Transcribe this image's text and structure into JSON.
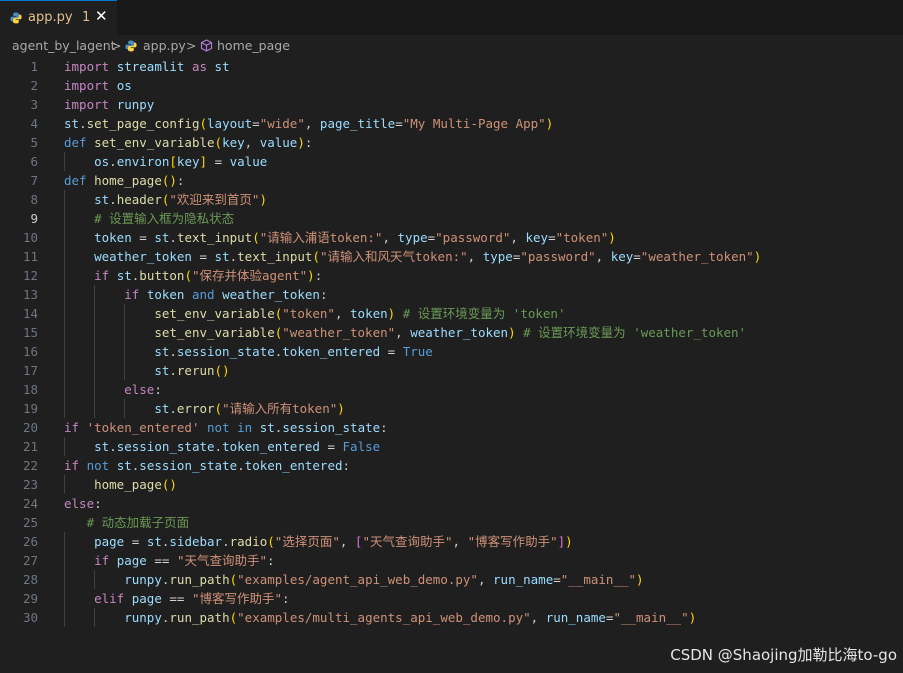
{
  "tab": {
    "filename": "app.py",
    "problem_count": "1",
    "close_symbol": "✕"
  },
  "breadcrumb": {
    "folder": "agent_by_lagent",
    "sep": ">",
    "file": "app.py",
    "symbol": "home_page"
  },
  "current_line": 9,
  "code_lines": [
    {
      "n": "1",
      "t": [
        [
          "import",
          "k"
        ],
        [
          " "
        ],
        [
          "streamlit",
          "v"
        ],
        [
          " "
        ],
        [
          "as",
          "k"
        ],
        [
          " "
        ],
        [
          "st",
          "v"
        ]
      ]
    },
    {
      "n": "2",
      "t": [
        [
          "import",
          "k"
        ],
        [
          " "
        ],
        [
          "os",
          "v"
        ]
      ]
    },
    {
      "n": "3",
      "t": [
        [
          "import",
          "k"
        ],
        [
          " "
        ],
        [
          "runpy",
          "v"
        ]
      ]
    },
    {
      "n": "4",
      "t": [
        [
          "st",
          "v"
        ],
        [
          "."
        ],
        [
          "set_page_config",
          "f"
        ],
        [
          "(",
          "p1"
        ],
        [
          "layout",
          "v"
        ],
        [
          "=",
          "op"
        ],
        [
          "\"wide\"",
          "s"
        ],
        [
          ", "
        ],
        [
          "page_title",
          "v"
        ],
        [
          "=",
          "op"
        ],
        [
          "\"My Multi-Page App\"",
          "s"
        ],
        [
          ")",
          "p1"
        ]
      ]
    },
    {
      "n": "5",
      "t": [
        [
          "def",
          "kb"
        ],
        [
          " "
        ],
        [
          "set_env_variable",
          "f"
        ],
        [
          "(",
          "p1"
        ],
        [
          "key",
          "v"
        ],
        [
          ", "
        ],
        [
          "value",
          "v"
        ],
        [
          ")",
          "p1"
        ],
        [
          ":"
        ]
      ]
    },
    {
      "n": "6",
      "t": [
        [
          "    "
        ],
        [
          "os",
          "v"
        ],
        [
          "."
        ],
        [
          "environ",
          "v"
        ],
        [
          "[",
          "p1"
        ],
        [
          "key",
          "v"
        ],
        [
          "]",
          "p1"
        ],
        [
          " "
        ],
        [
          "=",
          "op"
        ],
        [
          " "
        ],
        [
          "value",
          "v"
        ]
      ]
    },
    {
      "n": "7",
      "t": [
        [
          "def",
          "kb"
        ],
        [
          " "
        ],
        [
          "home_page",
          "f"
        ],
        [
          "(",
          "p1"
        ],
        [
          ")",
          "p1"
        ],
        [
          ":"
        ]
      ]
    },
    {
      "n": "8",
      "t": [
        [
          "    "
        ],
        [
          "st",
          "v"
        ],
        [
          "."
        ],
        [
          "header",
          "f"
        ],
        [
          "(",
          "p1"
        ],
        [
          "\"欢迎来到首页\"",
          "s"
        ],
        [
          ")",
          "p1"
        ]
      ]
    },
    {
      "n": "9",
      "t": [
        [
          "    "
        ],
        [
          "# 设置输入框为隐私状态",
          "c"
        ]
      ]
    },
    {
      "n": "10",
      "t": [
        [
          "    "
        ],
        [
          "token",
          "v"
        ],
        [
          " "
        ],
        [
          "=",
          "op"
        ],
        [
          " "
        ],
        [
          "st",
          "v"
        ],
        [
          "."
        ],
        [
          "text_input",
          "f"
        ],
        [
          "(",
          "p1"
        ],
        [
          "\"请输入浦语token:\"",
          "s"
        ],
        [
          ", "
        ],
        [
          "type",
          "v"
        ],
        [
          "=",
          "op"
        ],
        [
          "\"password\"",
          "s"
        ],
        [
          ", "
        ],
        [
          "key",
          "v"
        ],
        [
          "=",
          "op"
        ],
        [
          "\"token\"",
          "s"
        ],
        [
          ")",
          "p1"
        ]
      ]
    },
    {
      "n": "11",
      "t": [
        [
          "    "
        ],
        [
          "weather_token",
          "v"
        ],
        [
          " "
        ],
        [
          "=",
          "op"
        ],
        [
          " "
        ],
        [
          "st",
          "v"
        ],
        [
          "."
        ],
        [
          "text_input",
          "f"
        ],
        [
          "(",
          "p1"
        ],
        [
          "\"请输入和风天气token:\"",
          "s"
        ],
        [
          ", "
        ],
        [
          "type",
          "v"
        ],
        [
          "=",
          "op"
        ],
        [
          "\"password\"",
          "s"
        ],
        [
          ", "
        ],
        [
          "key",
          "v"
        ],
        [
          "=",
          "op"
        ],
        [
          "\"weather_token\"",
          "s"
        ],
        [
          ")",
          "p1"
        ]
      ]
    },
    {
      "n": "12",
      "t": [
        [
          "    "
        ],
        [
          "if",
          "k"
        ],
        [
          " "
        ],
        [
          "st",
          "v"
        ],
        [
          "."
        ],
        [
          "button",
          "f"
        ],
        [
          "(",
          "p1"
        ],
        [
          "\"保存并体验agent\"",
          "s"
        ],
        [
          ")",
          "p1"
        ],
        [
          ":"
        ]
      ]
    },
    {
      "n": "13",
      "t": [
        [
          "        "
        ],
        [
          "if",
          "k"
        ],
        [
          " "
        ],
        [
          "token",
          "v"
        ],
        [
          " "
        ],
        [
          "and",
          "kb"
        ],
        [
          " "
        ],
        [
          "weather_token",
          "v"
        ],
        [
          ":"
        ]
      ]
    },
    {
      "n": "14",
      "t": [
        [
          "            "
        ],
        [
          "set_env_variable",
          "f"
        ],
        [
          "(",
          "p1"
        ],
        [
          "\"token\"",
          "s"
        ],
        [
          ", "
        ],
        [
          "token",
          "v"
        ],
        [
          ")",
          "p1"
        ],
        [
          " "
        ],
        [
          "# 设置环境变量为 'token'",
          "c"
        ]
      ]
    },
    {
      "n": "15",
      "t": [
        [
          "            "
        ],
        [
          "set_env_variable",
          "f"
        ],
        [
          "(",
          "p1"
        ],
        [
          "\"weather_token\"",
          "s"
        ],
        [
          ", "
        ],
        [
          "weather_token",
          "v"
        ],
        [
          ")",
          "p1"
        ],
        [
          " "
        ],
        [
          "# 设置环境变量为 'weather_token'",
          "c"
        ]
      ]
    },
    {
      "n": "16",
      "t": [
        [
          "            "
        ],
        [
          "st",
          "v"
        ],
        [
          "."
        ],
        [
          "session_state",
          "v"
        ],
        [
          "."
        ],
        [
          "token_entered",
          "v"
        ],
        [
          " "
        ],
        [
          "=",
          "op"
        ],
        [
          " "
        ],
        [
          "True",
          "kb"
        ]
      ]
    },
    {
      "n": "17",
      "t": [
        [
          "            "
        ],
        [
          "st",
          "v"
        ],
        [
          "."
        ],
        [
          "rerun",
          "f"
        ],
        [
          "(",
          "p1"
        ],
        [
          ")",
          "p1"
        ]
      ]
    },
    {
      "n": "18",
      "t": [
        [
          "        "
        ],
        [
          "else",
          "k"
        ],
        [
          ":"
        ]
      ]
    },
    {
      "n": "19",
      "t": [
        [
          "            "
        ],
        [
          "st",
          "v"
        ],
        [
          "."
        ],
        [
          "error",
          "f"
        ],
        [
          "(",
          "p1"
        ],
        [
          "\"请输入所有token\"",
          "s"
        ],
        [
          ")",
          "p1"
        ]
      ]
    },
    {
      "n": "20",
      "t": [
        [
          "if",
          "k"
        ],
        [
          " "
        ],
        [
          "'token_entered'",
          "s"
        ],
        [
          " "
        ],
        [
          "not",
          "kb"
        ],
        [
          " "
        ],
        [
          "in",
          "kb"
        ],
        [
          " "
        ],
        [
          "st",
          "v"
        ],
        [
          "."
        ],
        [
          "session_state",
          "v"
        ],
        [
          ":"
        ]
      ]
    },
    {
      "n": "21",
      "t": [
        [
          "    "
        ],
        [
          "st",
          "v"
        ],
        [
          "."
        ],
        [
          "session_state",
          "v"
        ],
        [
          "."
        ],
        [
          "token_entered",
          "v"
        ],
        [
          " "
        ],
        [
          "=",
          "op"
        ],
        [
          " "
        ],
        [
          "False",
          "kb"
        ]
      ]
    },
    {
      "n": "22",
      "t": [
        [
          "if",
          "k"
        ],
        [
          " "
        ],
        [
          "not",
          "kb"
        ],
        [
          " "
        ],
        [
          "st",
          "v"
        ],
        [
          "."
        ],
        [
          "session_state",
          "v"
        ],
        [
          "."
        ],
        [
          "token_entered",
          "v"
        ],
        [
          ":"
        ]
      ]
    },
    {
      "n": "23",
      "t": [
        [
          "    "
        ],
        [
          "home_page",
          "f"
        ],
        [
          "(",
          "p1"
        ],
        [
          ")",
          "p1"
        ]
      ]
    },
    {
      "n": "24",
      "t": [
        [
          "else",
          "k"
        ],
        [
          ":"
        ]
      ]
    },
    {
      "n": "25",
      "t": [
        [
          "   "
        ],
        [
          "# 动态加载子页面",
          "c"
        ]
      ]
    },
    {
      "n": "26",
      "t": [
        [
          "    "
        ],
        [
          "page",
          "v"
        ],
        [
          " "
        ],
        [
          "=",
          "op"
        ],
        [
          " "
        ],
        [
          "st",
          "v"
        ],
        [
          "."
        ],
        [
          "sidebar",
          "v"
        ],
        [
          "."
        ],
        [
          "radio",
          "f"
        ],
        [
          "(",
          "p1"
        ],
        [
          "\"选择页面\"",
          "s"
        ],
        [
          ", "
        ],
        [
          "[",
          "p2"
        ],
        [
          "\"天气查询助手\"",
          "s"
        ],
        [
          ", "
        ],
        [
          "\"博客写作助手\"",
          "s"
        ],
        [
          "]",
          "p2"
        ],
        [
          ")",
          "p1"
        ]
      ]
    },
    {
      "n": "27",
      "t": [
        [
          "    "
        ],
        [
          "if",
          "k"
        ],
        [
          " "
        ],
        [
          "page",
          "v"
        ],
        [
          " "
        ],
        [
          "==",
          "op"
        ],
        [
          " "
        ],
        [
          "\"天气查询助手\"",
          "s"
        ],
        [
          ":"
        ]
      ]
    },
    {
      "n": "28",
      "t": [
        [
          "        "
        ],
        [
          "runpy",
          "v"
        ],
        [
          "."
        ],
        [
          "run_path",
          "f"
        ],
        [
          "(",
          "p1"
        ],
        [
          "\"examples/agent_api_web_demo.py\"",
          "s"
        ],
        [
          ", "
        ],
        [
          "run_name",
          "v"
        ],
        [
          "=",
          "op"
        ],
        [
          "\"__main__\"",
          "s"
        ],
        [
          ")",
          "p1"
        ]
      ]
    },
    {
      "n": "29",
      "t": [
        [
          "    "
        ],
        [
          "elif",
          "k"
        ],
        [
          " "
        ],
        [
          "page",
          "v"
        ],
        [
          " "
        ],
        [
          "==",
          "op"
        ],
        [
          " "
        ],
        [
          "\"博客写作助手\"",
          "s"
        ],
        [
          ":"
        ]
      ]
    },
    {
      "n": "30",
      "t": [
        [
          "        "
        ],
        [
          "runpy",
          "v"
        ],
        [
          "."
        ],
        [
          "run_path",
          "f"
        ],
        [
          "(",
          "p1"
        ],
        [
          "\"examples/multi_agents_api_web_demo.py\"",
          "s"
        ],
        [
          ", "
        ],
        [
          "run_name",
          "v"
        ],
        [
          "=",
          "op"
        ],
        [
          "\"__main__\"",
          "s"
        ],
        [
          ")",
          "p1"
        ]
      ]
    }
  ],
  "watermark": "CSDN @Shaojing加勒比海to-go"
}
